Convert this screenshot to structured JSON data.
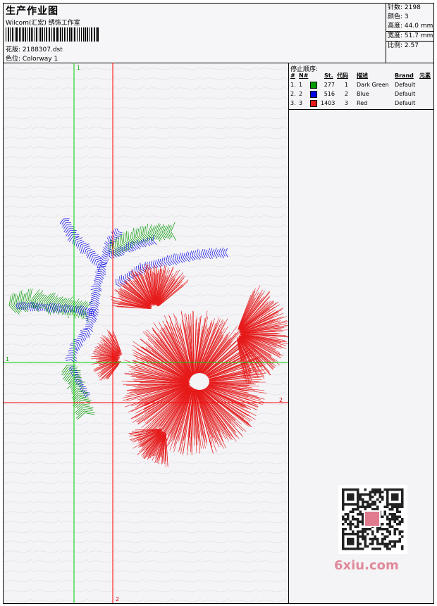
{
  "header": {
    "title": "生产作业图",
    "company": "Wilcom(汇宏) 绣饰工作室",
    "design_file": "花版: 2188307.dst",
    "colorway": "色位: Colorway 1"
  },
  "stats": [
    {
      "label": "针数:",
      "value": "2198"
    },
    {
      "label": "颜色:",
      "value": "3"
    },
    {
      "label": "高度:",
      "value": "44.0 mm"
    },
    {
      "label": "宽度:",
      "value": "51.7 mm"
    },
    {
      "label": "比例:",
      "value": "2.57"
    }
  ],
  "stop_sequence": {
    "title": "停止顺序:",
    "headers": {
      "index": "#",
      "needle": "N#",
      "stitches": "St.",
      "code": "代码",
      "description": "描述",
      "brand": "Brand",
      "element": "元素"
    },
    "rows": [
      {
        "index": "1.",
        "needle": "1",
        "color": "#009a00",
        "stitches": "277",
        "code": "1",
        "description": "Dark Green",
        "brand": "Default"
      },
      {
        "index": "2.",
        "needle": "2",
        "color": "#0000e6",
        "stitches": "516",
        "code": "2",
        "description": "Blue",
        "brand": "Default"
      },
      {
        "index": "3.",
        "needle": "3",
        "color": "#e61a1a",
        "stitches": "1403",
        "code": "3",
        "description": "Red",
        "brand": "Default"
      }
    ]
  },
  "guides": {
    "green_vertical": "1",
    "green_horizontal": "1",
    "red_vertical": "2",
    "red_horizontal": "2"
  },
  "colors": {
    "green": "#009a00",
    "blue": "#0000e6",
    "red": "#e61a1a",
    "guide_green": "#00d000",
    "guide_red": "#ff0000"
  },
  "watermark": "6xiu.com"
}
